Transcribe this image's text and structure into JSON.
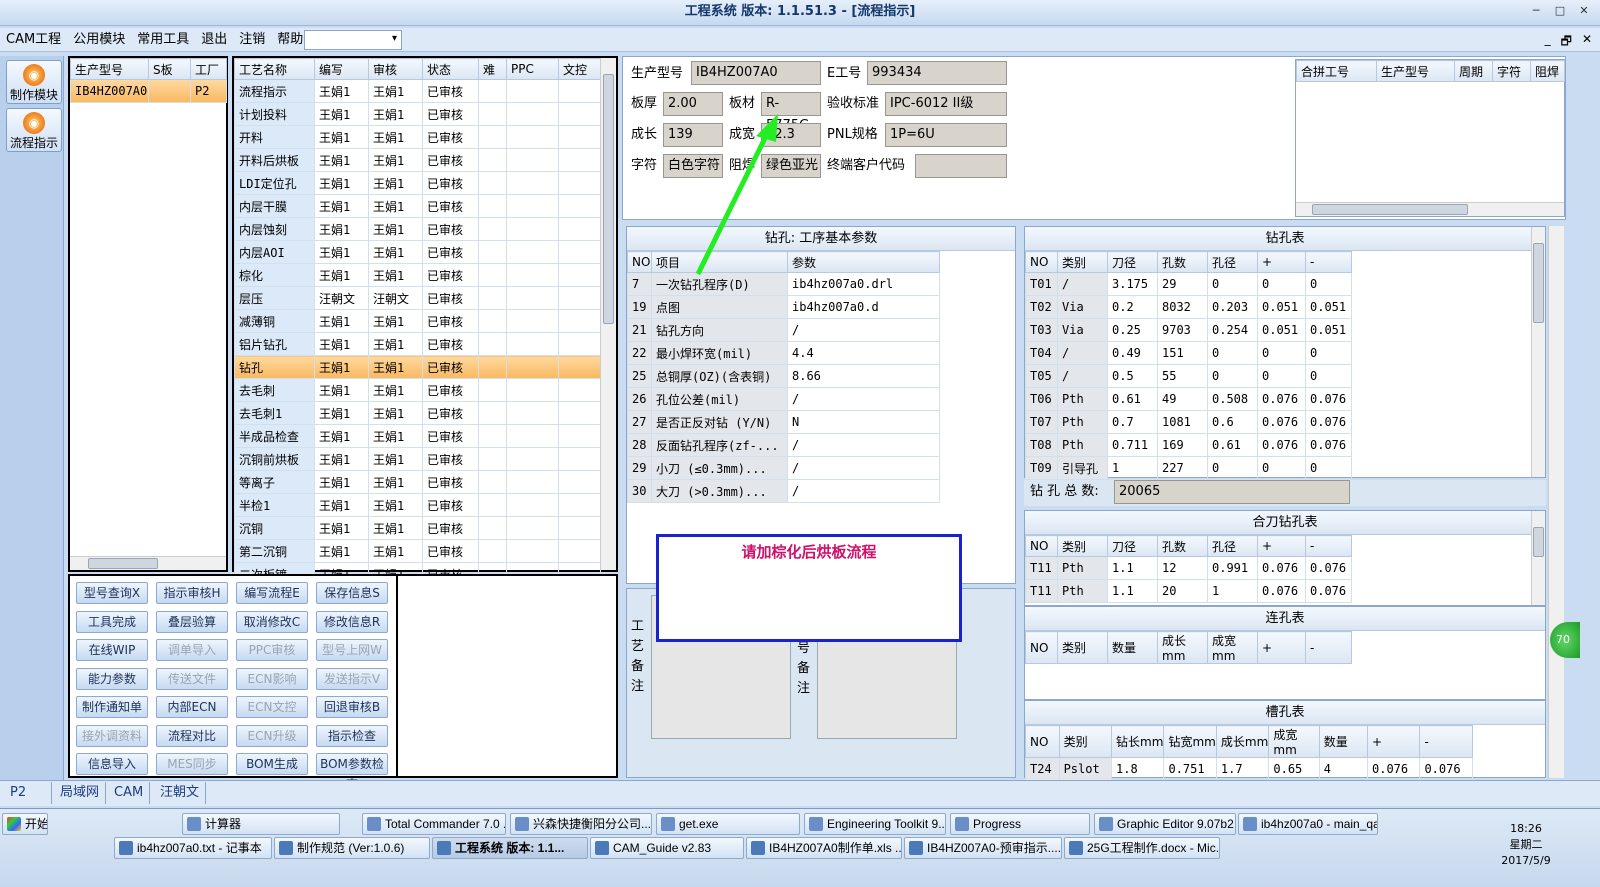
{
  "window": {
    "title": "工程系统   版本: 1.1.51.3 - [流程指示]",
    "min": "─",
    "max": "□",
    "close": "✕"
  },
  "menu": {
    "items": [
      "CAM工程",
      "公用模块",
      "常用工具",
      "退出",
      "注销",
      "帮助"
    ],
    "dropdown_arrow": "▾",
    "mdi": [
      "_",
      "🗗",
      "✕"
    ]
  },
  "rail": [
    {
      "label": "制作模块"
    },
    {
      "label": "流程指示"
    }
  ],
  "models": {
    "headers": [
      "生产型号",
      "S板",
      "工厂"
    ],
    "rows": [
      [
        "IB4HZ007A0",
        "",
        "P2"
      ]
    ]
  },
  "process": {
    "headers": [
      "工艺名称",
      "编写",
      "审核",
      "状态",
      "难",
      "PPC",
      "文控"
    ],
    "selected_index": 12,
    "rows": [
      [
        "流程指示",
        "王娟1",
        "王娟1",
        "已审核"
      ],
      [
        "计划投料",
        "王娟1",
        "王娟1",
        "已审核"
      ],
      [
        "开料",
        "王娟1",
        "王娟1",
        "已审核"
      ],
      [
        "开料后烘板",
        "王娟1",
        "王娟1",
        "已审核"
      ],
      [
        "LDI定位孔",
        "王娟1",
        "王娟1",
        "已审核"
      ],
      [
        "内层干膜",
        "王娟1",
        "王娟1",
        "已审核"
      ],
      [
        "内层蚀刻",
        "王娟1",
        "王娟1",
        "已审核"
      ],
      [
        "内层AOI",
        "王娟1",
        "王娟1",
        "已审核"
      ],
      [
        "棕化",
        "王娟1",
        "王娟1",
        "已审核"
      ],
      [
        "层压",
        "汪朝文",
        "汪朝文",
        "已审核"
      ],
      [
        "减薄铜",
        "王娟1",
        "王娟1",
        "已审核"
      ],
      [
        "铝片钻孔",
        "王娟1",
        "王娟1",
        "已审核"
      ],
      [
        "钻孔",
        "王娟1",
        "王娟1",
        "已审核"
      ],
      [
        "去毛刺",
        "王娟1",
        "王娟1",
        "已审核"
      ],
      [
        "去毛刺1",
        "王娟1",
        "王娟1",
        "已审核"
      ],
      [
        "半成品检查",
        "王娟1",
        "王娟1",
        "已审核"
      ],
      [
        "沉铜前烘板",
        "王娟1",
        "王娟1",
        "已审核"
      ],
      [
        "等离子",
        "王娟1",
        "王娟1",
        "已审核"
      ],
      [
        "半检1",
        "王娟1",
        "王娟1",
        "已审核"
      ],
      [
        "沉铜",
        "王娟1",
        "王娟1",
        "已审核"
      ],
      [
        "第二沉铜",
        "王娟1",
        "王娟1",
        "已审核"
      ],
      [
        "二次板镀",
        "王娟1",
        "王娟1",
        "已审核"
      ]
    ]
  },
  "buttons": [
    [
      "型号查询X",
      true
    ],
    [
      "指示审核H",
      true
    ],
    [
      "编写流程E",
      true
    ],
    [
      "保存信息S",
      true
    ],
    [
      "工具完成",
      true
    ],
    [
      "叠层验算",
      true
    ],
    [
      "取消修改C",
      true
    ],
    [
      "修改信息R",
      true
    ],
    [
      "在线WIP",
      true
    ],
    [
      "调单导入",
      false
    ],
    [
      "PPC审核",
      false
    ],
    [
      "型号上网W",
      false
    ],
    [
      "能力参数",
      true
    ],
    [
      "传送文件",
      false
    ],
    [
      "ECN影响",
      false
    ],
    [
      "发送指示V",
      false
    ],
    [
      "制作通知单",
      true
    ],
    [
      "内部ECN",
      true
    ],
    [
      "ECN文控",
      false
    ],
    [
      "回退审核B",
      true
    ],
    [
      "接外调资料",
      false
    ],
    [
      "流程对比",
      true
    ],
    [
      "ECN升级",
      false
    ],
    [
      "指示检查",
      true
    ],
    [
      "信息导入",
      true
    ],
    [
      "MES同步",
      false
    ],
    [
      "BOM生成",
      true
    ],
    [
      "BOM参数检查",
      true
    ]
  ],
  "info": {
    "model_label": "生产型号",
    "model": "IB4HZ007A0",
    "eno_label": "E工号",
    "eno": "993434",
    "thick_label": "板厚",
    "thick": "2.00",
    "mat_label": "板材",
    "mat": "R-5775G",
    "accept_label": "验收标准",
    "accept": "IPC-6012 II级",
    "len_label": "成长",
    "len": "139",
    "wid_label": "成宽",
    "wid": "12.3",
    "pnl_label": "PNL规格",
    "pnl": "1P=6U",
    "char_label": "字符",
    "char": "白色字符",
    "mask_label": "阻焊",
    "mask": "绿色亚光",
    "cust_label": "终端客户代码",
    "cust": ""
  },
  "merge": {
    "headers": [
      "合拼工号",
      "生产型号",
      "周期",
      "字符",
      "阻焊"
    ]
  },
  "drill_params": {
    "title": "钻孔: 工序基本参数",
    "headers": [
      "NO",
      "项目",
      "参数"
    ],
    "rows": [
      [
        "7",
        "一次钻孔程序(D)",
        "ib4hz007a0.drl"
      ],
      [
        "19",
        "点图",
        "ib4hz007a0.d"
      ],
      [
        "21",
        "钻孔方向",
        "/"
      ],
      [
        "22",
        "最小焊环宽(mil)",
        "4.4"
      ],
      [
        "25",
        "总铜厚(OZ)(含表铜)",
        "8.66"
      ],
      [
        "26",
        "孔位公差(mil)",
        "/"
      ],
      [
        "27",
        "是否正反对钻 (Y/N)",
        "N"
      ],
      [
        "28",
        "反面钻孔程序(zf-...",
        "/"
      ],
      [
        "29",
        "小刀 (≤0.3mm)...",
        "/"
      ],
      [
        "30",
        "大刀 (>0.3mm)...",
        "/"
      ]
    ]
  },
  "drill_table": {
    "title": "钻孔表",
    "headers": [
      "NO",
      "类别",
      "刀径",
      "孔数",
      "孔径",
      "+",
      "-"
    ],
    "rows": [
      [
        "T01",
        "/",
        "3.175",
        "29",
        "0",
        "0",
        "0"
      ],
      [
        "T02",
        "Via",
        "0.2",
        "8032",
        "0.203",
        "0.051",
        "0.051"
      ],
      [
        "T03",
        "Via",
        "0.25",
        "9703",
        "0.254",
        "0.051",
        "0.051"
      ],
      [
        "T04",
        "/",
        "0.49",
        "151",
        "0",
        "0",
        "0"
      ],
      [
        "T05",
        "/",
        "0.5",
        "55",
        "0",
        "0",
        "0"
      ],
      [
        "T06",
        "Pth",
        "0.61",
        "49",
        "0.508",
        "0.076",
        "0.076"
      ],
      [
        "T07",
        "Pth",
        "0.7",
        "1081",
        "0.6",
        "0.076",
        "0.076"
      ],
      [
        "T08",
        "Pth",
        "0.711",
        "169",
        "0.61",
        "0.076",
        "0.076"
      ],
      [
        "T09",
        "引导孔",
        "1",
        "227",
        "0",
        "0",
        "0"
      ]
    ],
    "total_label": "钻 孔 总 数:",
    "total": "20065"
  },
  "combo_table": {
    "title": "合刀钻孔表",
    "headers": [
      "NO",
      "类别",
      "刀径",
      "孔数",
      "孔径",
      "+",
      "-"
    ],
    "rows": [
      [
        "T11",
        "Pth",
        "1.1",
        "12",
        "0.991",
        "0.076",
        "0.076"
      ],
      [
        "T11",
        "Pth",
        "1.1",
        "20",
        "1",
        "0.076",
        "0.076"
      ]
    ]
  },
  "link_table": {
    "title": "连孔表",
    "headers": [
      "NO",
      "类别",
      "数量",
      "成长mm",
      "成宽mm",
      "+",
      "-"
    ]
  },
  "slot_table": {
    "title": "槽孔表",
    "headers": [
      "NO",
      "类别",
      "钻长mm",
      "钻宽mm",
      "成长mm",
      "成宽mm",
      "数量",
      "+",
      "-"
    ],
    "rows": [
      [
        "T24",
        "Pslot",
        "1.8",
        "0.751",
        "1.7",
        "0.65",
        "4",
        "0.076",
        "0.076"
      ]
    ]
  },
  "notes": {
    "left": "工艺备注",
    "right": "号备注"
  },
  "annotation": {
    "text": "请加棕化后烘板流程",
    "color": "#d0106a"
  },
  "badge": "70",
  "tabs": [
    "P2",
    "局域网",
    "CAM",
    "汪朝文"
  ],
  "taskbar": {
    "start": "开始",
    "row1": [
      "计算器",
      "Total Commander 7.0 ...",
      "兴森快捷衡阳分公司...",
      "get.exe",
      "Engineering Toolkit 9....",
      "Progress",
      "Graphic Editor 9.07b2 ...",
      "ib4hz007a0 - main_qa"
    ],
    "row2": [
      "ib4hz007a0.txt - 记事本",
      "制作规范 (Ver:1.0.6)",
      "工程系统  版本: 1.1...",
      "CAM_Guide v2.83",
      "IB4HZ007A0制作单.xls ...",
      "IB4HZ007A0-预审指示....",
      "25G工程制作.docx - Mic..."
    ],
    "time": "18:26",
    "day": "星期二",
    "date": "2017/5/9"
  }
}
